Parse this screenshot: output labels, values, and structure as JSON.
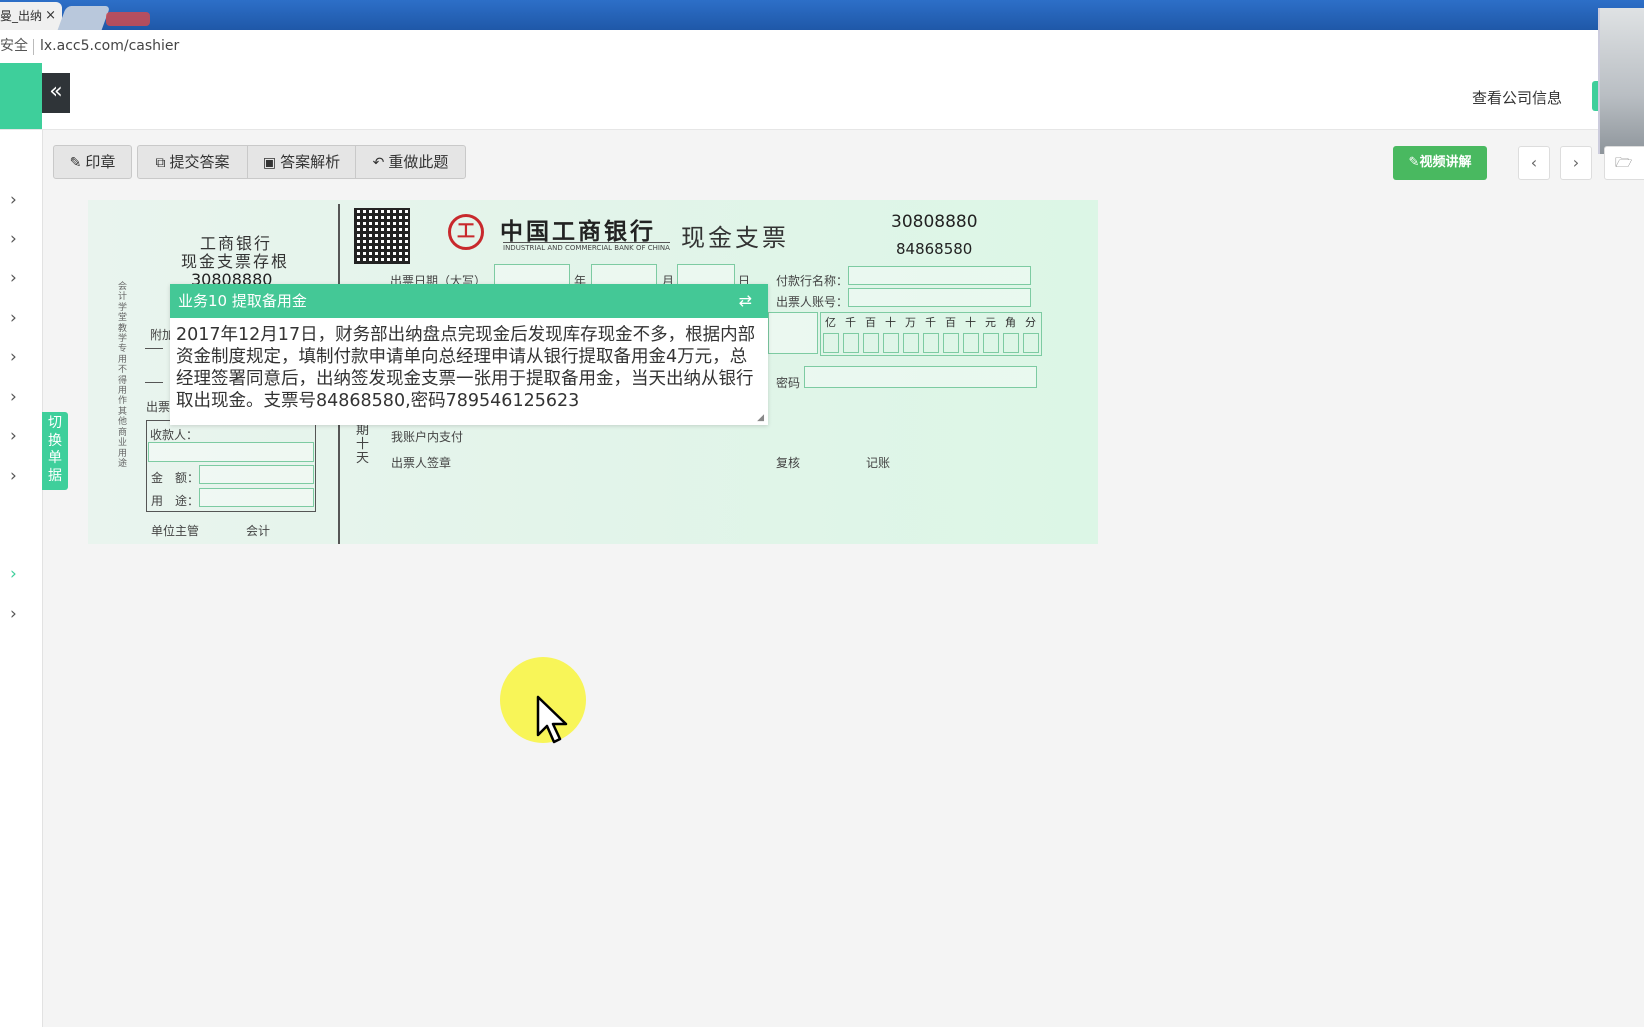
{
  "browser": {
    "tab_title": "曼_出纳",
    "tab_close": "×",
    "security_label": "安全",
    "url": "lx.acc5.com/cashier"
  },
  "header": {
    "collapse_icon": "«",
    "company_link": "查看公司信息",
    "accent_color": "#3ecf9b"
  },
  "sidebar": {
    "chevron": "›",
    "switch_tab": [
      "切",
      "换",
      "单",
      "据"
    ]
  },
  "toolbar": {
    "stamp": "印章",
    "submit": "提交答案",
    "analysis": "答案解析",
    "redo": "重做此题",
    "video": "视频讲解",
    "prev": "‹",
    "next": "›",
    "folder_icon": "folder-open-icon"
  },
  "cheque": {
    "stub": {
      "title_line1": "工商银行",
      "title_line2": "现金支票存根",
      "number": "30808880",
      "vertical_note": "会计学堂教学专用 不得用作其他商业用途",
      "fujia": "附加",
      "chupiao": "出票",
      "payee_label": "收款人：",
      "amount_label": "金　额：",
      "use_label": "用　途：",
      "supervisor": "单位主管",
      "accountant": "会计"
    },
    "bank_name": "中国工商银行",
    "bank_name_en": "INDUSTRIAL AND COMMERCIAL BANK OF CHINA",
    "logo_glyph": "工",
    "type": "现金支票",
    "code": "30808880",
    "number": "84868580",
    "date_label": "出票日期（大写）",
    "year": "年",
    "month": "月",
    "day": "日",
    "payer_bank_label": "付款行名称：",
    "drawer_account_label": "出票人账号：",
    "units": [
      "亿",
      "千",
      "百",
      "十",
      "万",
      "千",
      "百",
      "十",
      "元",
      "角",
      "分"
    ],
    "password_label": "密码",
    "period": "期十天",
    "self_pay": "我账户内支付",
    "signature": "出票人签章",
    "review": "复核",
    "bookkeeping": "记账"
  },
  "task": {
    "title": "业务10 提取备用金",
    "swap_icon": "⇄",
    "text": "2017年12月17日，财务部出纳盘点完现金后发现库存现金不多，根据内部资金制度规定，填制付款申请单向总经理申请从银行提取备用金4万元，总经理签署同意后，出纳签发现金支票一张用于提取备用金，当天出纳从银行取出现金。支票号84868580,密码789546125623"
  }
}
